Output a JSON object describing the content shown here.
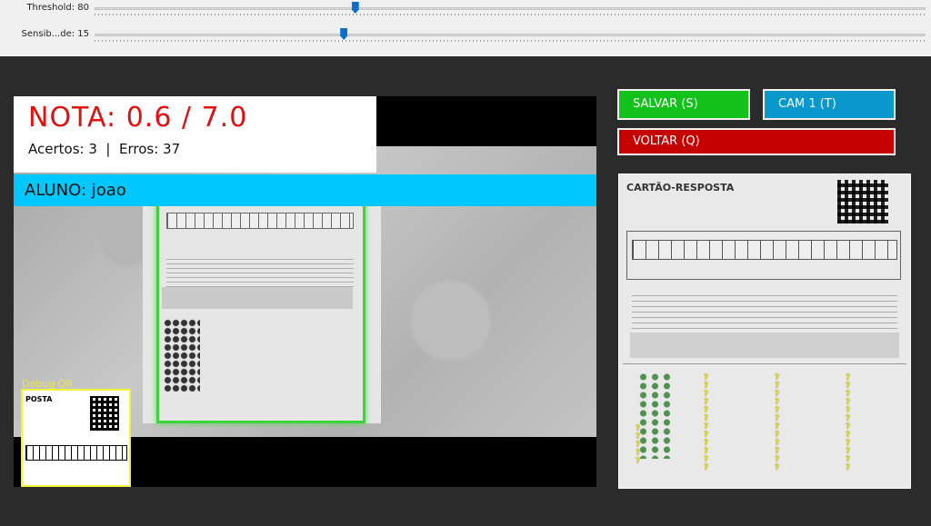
{
  "trackbars": [
    {
      "label": "Threshold: 80",
      "value": 80,
      "max": 255
    },
    {
      "label": "Sensib...de: 15",
      "value": 15,
      "max": 50
    }
  ],
  "result": {
    "nota": "NOTA: 0.6 / 7.0",
    "counts": "Acertos: 3  |  Erros: 37",
    "aluno": "ALUNO: joao"
  },
  "debug": {
    "label": "Debug QR",
    "snippet_text": "POSTA"
  },
  "buttons": {
    "salvar": "SALVAR (S)",
    "cam": "CAM 1 (T)",
    "voltar": "VOLTAR (Q)"
  },
  "preview": {
    "title": "CARTÃO-RESPOSTA",
    "unanswered_mark": "?"
  },
  "colors": {
    "accent_blue": "#00c8ff",
    "score_red": "#e01010",
    "save_green": "#12c21a",
    "back_red": "#c50000",
    "cam_blue": "#0a97cc"
  }
}
